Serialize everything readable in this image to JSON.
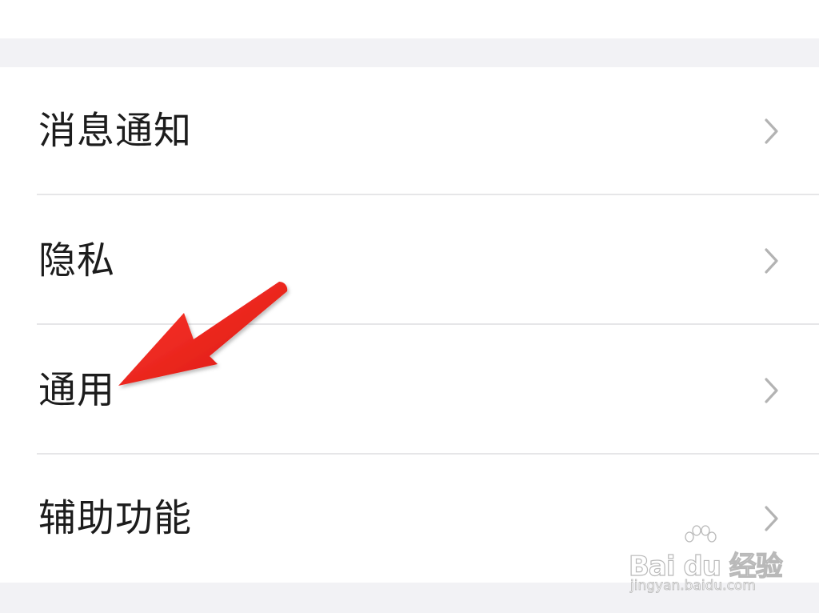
{
  "settings": {
    "items": [
      {
        "label": "消息通知",
        "icon": "chevron-right-icon"
      },
      {
        "label": "隐私",
        "icon": "chevron-right-icon"
      },
      {
        "label": "通用",
        "icon": "chevron-right-icon"
      },
      {
        "label": "辅助功能",
        "icon": "chevron-right-icon"
      }
    ]
  },
  "annotation": {
    "icon": "red-arrow-icon",
    "color": "#e8211d",
    "points_to": "通用"
  },
  "watermark": {
    "logo": "Bai du 经验",
    "site": "jingyan.baidu.com"
  },
  "colors": {
    "background": "#f2f2f5",
    "card": "#ffffff",
    "text": "#1c1c1c",
    "chevron": "#b3b3b3",
    "divider": "#e6e6e8"
  }
}
